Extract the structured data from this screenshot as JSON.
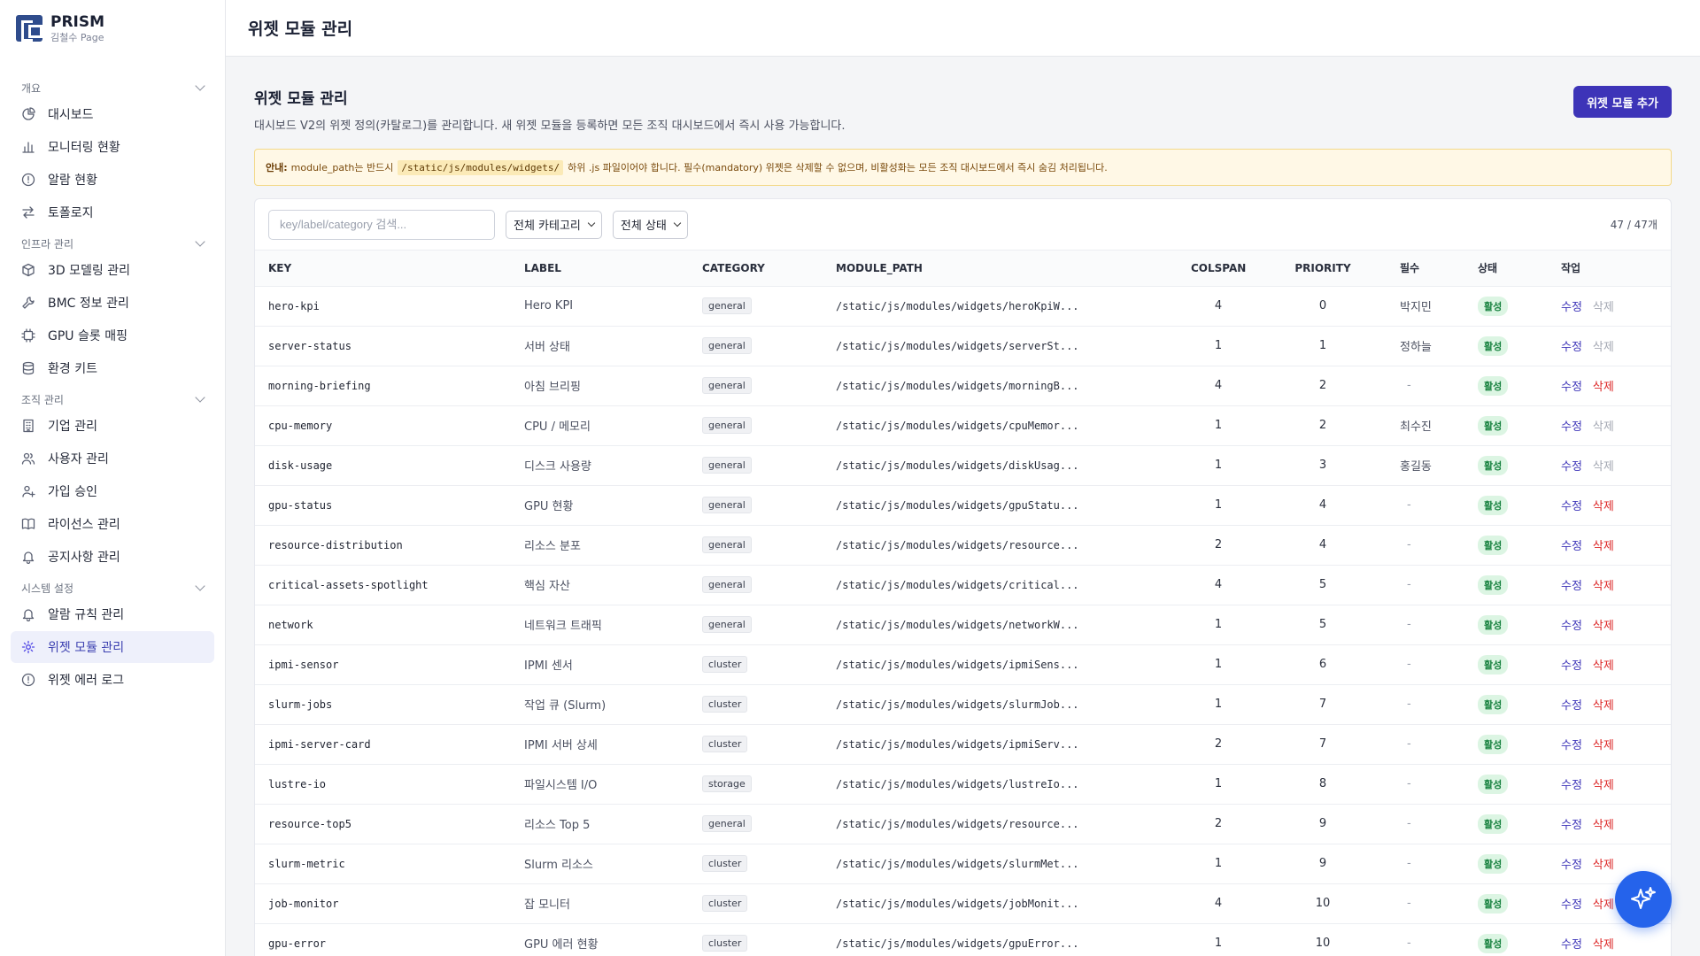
{
  "brand": {
    "title": "PRISM",
    "subtitle": "김철수 Page"
  },
  "topbar": {
    "title": "위젯 모듈 관리"
  },
  "sidebar": {
    "sections": [
      {
        "label": "개요",
        "items": [
          {
            "label": "대시보드",
            "icon": "pie-chart-icon"
          },
          {
            "label": "모니터링 현황",
            "icon": "bar-chart-icon"
          },
          {
            "label": "알람 현황",
            "icon": "alert-circle-icon"
          },
          {
            "label": "토폴로지",
            "icon": "arrows-icon"
          }
        ]
      },
      {
        "label": "인프라 관리",
        "items": [
          {
            "label": "3D 모델링 관리",
            "icon": "cube-icon"
          },
          {
            "label": "BMC 정보 관리",
            "icon": "wrench-icon"
          },
          {
            "label": "GPU 슬롯 매핑",
            "icon": "chip-icon"
          },
          {
            "label": "환경 키트",
            "icon": "database-icon"
          }
        ]
      },
      {
        "label": "조직 관리",
        "items": [
          {
            "label": "기업 관리",
            "icon": "building-icon"
          },
          {
            "label": "사용자 관리",
            "icon": "users-icon"
          },
          {
            "label": "가입 승인",
            "icon": "user-plus-icon"
          },
          {
            "label": "라이선스 관리",
            "icon": "book-icon"
          },
          {
            "label": "공지사항 관리",
            "icon": "bell-icon"
          }
        ]
      },
      {
        "label": "시스템 설정",
        "items": [
          {
            "label": "알람 규칙 관리",
            "icon": "bell-icon"
          },
          {
            "label": "위젯 모듈 관리",
            "icon": "gear-icon",
            "active": true
          },
          {
            "label": "위젯 에러 로그",
            "icon": "alert-circle-icon"
          }
        ]
      }
    ]
  },
  "page": {
    "title": "위젯 모듈 관리",
    "description": "대시보드 V2의 위젯 정의(카탈로그)를 관리합니다. 새 위젯 모듈을 등록하면 모든 조직 대시보드에서 즉시 사용 가능합니다.",
    "add_button": "위젯 모듈 추가"
  },
  "notice": {
    "label": "안내:",
    "text_before": "module_path는 반드시",
    "code": "/static/js/modules/widgets/",
    "text_after": "하위 .js 파일이어야 합니다. 필수(mandatory) 위젯은 삭제할 수 없으며, 비활성화는 모든 조직 대시보드에서 즉시 숨김 처리됩니다."
  },
  "filters": {
    "search_placeholder": "key/label/category 검색...",
    "category_select": "전체 카테고리",
    "status_select": "전체 상태",
    "count": "47 / 47개"
  },
  "table": {
    "headers": [
      "KEY",
      "LABEL",
      "CATEGORY",
      "MODULE_PATH",
      "COLSPAN",
      "PRIORITY",
      "필수",
      "상태",
      "작업"
    ],
    "edit_label": "수정",
    "delete_label": "삭제",
    "rows": [
      {
        "key": "hero-kpi",
        "label": "Hero KPI",
        "category": "general",
        "path": "/static/js/modules/widgets/heroKpiW...",
        "colspan": "4",
        "priority": "0",
        "required": "박지민",
        "status": "활성",
        "deletable": false
      },
      {
        "key": "server-status",
        "label": "서버 상태",
        "category": "general",
        "path": "/static/js/modules/widgets/serverSt...",
        "colspan": "1",
        "priority": "1",
        "required": "정하늘",
        "status": "활성",
        "deletable": false
      },
      {
        "key": "morning-briefing",
        "label": "아침 브리핑",
        "category": "general",
        "path": "/static/js/modules/widgets/morningB...",
        "colspan": "4",
        "priority": "2",
        "required": "-",
        "status": "활성",
        "deletable": true
      },
      {
        "key": "cpu-memory",
        "label": "CPU / 메모리",
        "category": "general",
        "path": "/static/js/modules/widgets/cpuMemor...",
        "colspan": "1",
        "priority": "2",
        "required": "최수진",
        "status": "활성",
        "deletable": false
      },
      {
        "key": "disk-usage",
        "label": "디스크 사용량",
        "category": "general",
        "path": "/static/js/modules/widgets/diskUsag...",
        "colspan": "1",
        "priority": "3",
        "required": "홍길동",
        "status": "활성",
        "deletable": false
      },
      {
        "key": "gpu-status",
        "label": "GPU 현황",
        "category": "general",
        "path": "/static/js/modules/widgets/gpuStatu...",
        "colspan": "1",
        "priority": "4",
        "required": "-",
        "status": "활성",
        "deletable": true
      },
      {
        "key": "resource-distribution",
        "label": "리소스 분포",
        "category": "general",
        "path": "/static/js/modules/widgets/resource...",
        "colspan": "2",
        "priority": "4",
        "required": "-",
        "status": "활성",
        "deletable": true
      },
      {
        "key": "critical-assets-spotlight",
        "label": "핵심 자산",
        "category": "general",
        "path": "/static/js/modules/widgets/critical...",
        "colspan": "4",
        "priority": "5",
        "required": "-",
        "status": "활성",
        "deletable": true
      },
      {
        "key": "network",
        "label": "네트워크 트래픽",
        "category": "general",
        "path": "/static/js/modules/widgets/networkW...",
        "colspan": "1",
        "priority": "5",
        "required": "-",
        "status": "활성",
        "deletable": true
      },
      {
        "key": "ipmi-sensor",
        "label": "IPMI 센서",
        "category": "cluster",
        "path": "/static/js/modules/widgets/ipmiSens...",
        "colspan": "1",
        "priority": "6",
        "required": "-",
        "status": "활성",
        "deletable": true
      },
      {
        "key": "slurm-jobs",
        "label": "작업 큐 (Slurm)",
        "category": "cluster",
        "path": "/static/js/modules/widgets/slurmJob...",
        "colspan": "1",
        "priority": "7",
        "required": "-",
        "status": "활성",
        "deletable": true
      },
      {
        "key": "ipmi-server-card",
        "label": "IPMI 서버 상세",
        "category": "cluster",
        "path": "/static/js/modules/widgets/ipmiServ...",
        "colspan": "2",
        "priority": "7",
        "required": "-",
        "status": "활성",
        "deletable": true
      },
      {
        "key": "lustre-io",
        "label": "파일시스템 I/O",
        "category": "storage",
        "path": "/static/js/modules/widgets/lustreIo...",
        "colspan": "1",
        "priority": "8",
        "required": "-",
        "status": "활성",
        "deletable": true
      },
      {
        "key": "resource-top5",
        "label": "리소스 Top 5",
        "category": "general",
        "path": "/static/js/modules/widgets/resource...",
        "colspan": "2",
        "priority": "9",
        "required": "-",
        "status": "활성",
        "deletable": true
      },
      {
        "key": "slurm-metric",
        "label": "Slurm 리소스",
        "category": "cluster",
        "path": "/static/js/modules/widgets/slurmMet...",
        "colspan": "1",
        "priority": "9",
        "required": "-",
        "status": "활성",
        "deletable": true
      },
      {
        "key": "job-monitor",
        "label": "잡 모니터",
        "category": "cluster",
        "path": "/static/js/modules/widgets/jobMonit...",
        "colspan": "4",
        "priority": "10",
        "required": "-",
        "status": "활성",
        "deletable": true
      },
      {
        "key": "gpu-error",
        "label": "GPU 에러 현황",
        "category": "cluster",
        "path": "/static/js/modules/widgets/gpuError...",
        "colspan": "1",
        "priority": "10",
        "required": "-",
        "status": "활성",
        "deletable": true
      }
    ]
  },
  "colors": {
    "accent": "#3d34b8",
    "active_bg": "#eef0fb",
    "status_bg": "#dcf5e3",
    "status_text": "#15803d",
    "delete": "#dc2626",
    "fab": "#2563eb"
  },
  "fab": {
    "icon": "sparkle-icon"
  }
}
